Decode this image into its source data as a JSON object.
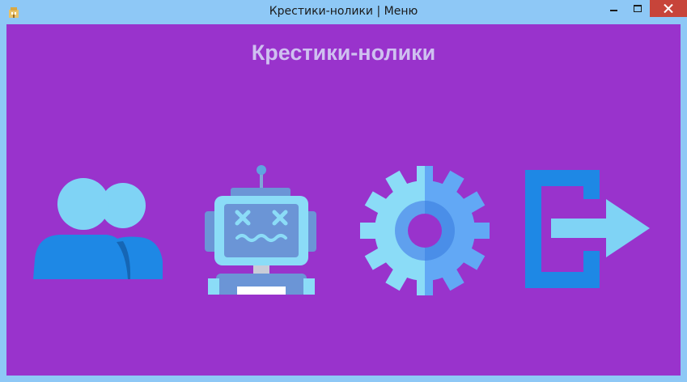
{
  "window": {
    "title": "Крестики-нолики | Меню"
  },
  "main": {
    "heading": "Крестики-нолики"
  },
  "menu": {
    "items": [
      {
        "icon": "users-icon"
      },
      {
        "icon": "robot-icon"
      },
      {
        "icon": "gear-icon"
      },
      {
        "icon": "exit-icon"
      }
    ]
  },
  "colors": {
    "background": "#9933cc",
    "titlebar": "#8ec8f6",
    "heading": "#cfc0f0",
    "close": "#c7443a",
    "icon_light": "#7fd3f5",
    "icon_dark": "#1e88e5"
  }
}
